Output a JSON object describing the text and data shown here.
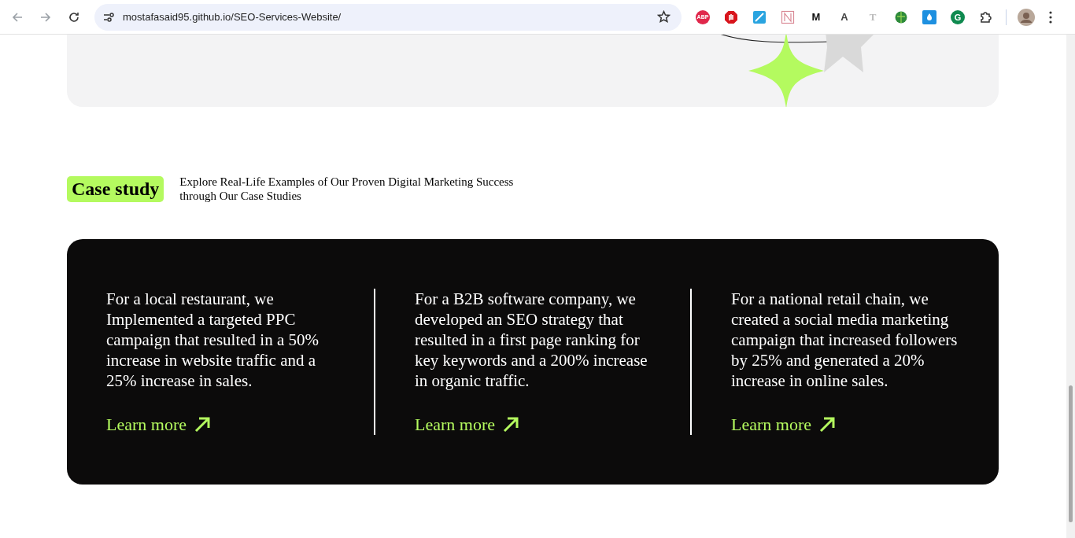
{
  "browser": {
    "url": "mostafasaid95.github.io/SEO-Services-Website/",
    "extensions": [
      {
        "kind": "stop",
        "label": "ABP"
      },
      {
        "kind": "hand"
      },
      {
        "kind": "tile"
      },
      {
        "kind": "frame"
      },
      {
        "kind": "letter",
        "label": "M"
      },
      {
        "kind": "doc",
        "label": "A"
      },
      {
        "kind": "plain",
        "label": "T"
      },
      {
        "kind": "globe"
      },
      {
        "kind": "drop"
      },
      {
        "kind": "circle",
        "label": "G"
      },
      {
        "kind": "puzzle"
      }
    ]
  },
  "case_study": {
    "badge": "Case study",
    "description": "Explore Real-Life Examples of Our Proven Digital Marketing Success through Our Case Studies"
  },
  "cases": [
    {
      "text": "For a local restaurant, we Implemented a targeted PPC campaign that resulted in a 50% increase in website traffic and a 25% increase in sales.",
      "link": "Learn more"
    },
    {
      "text": "For a B2B software company, we developed an SEO strategy that resulted in a first page ranking for key keywords and a 200% increase in organic traffic.",
      "link": "Learn more"
    },
    {
      "text": "For a national retail chain, we created a social media marketing campaign that increased followers by 25% and generated a 20% increase in online sales.",
      "link": "Learn more"
    }
  ]
}
